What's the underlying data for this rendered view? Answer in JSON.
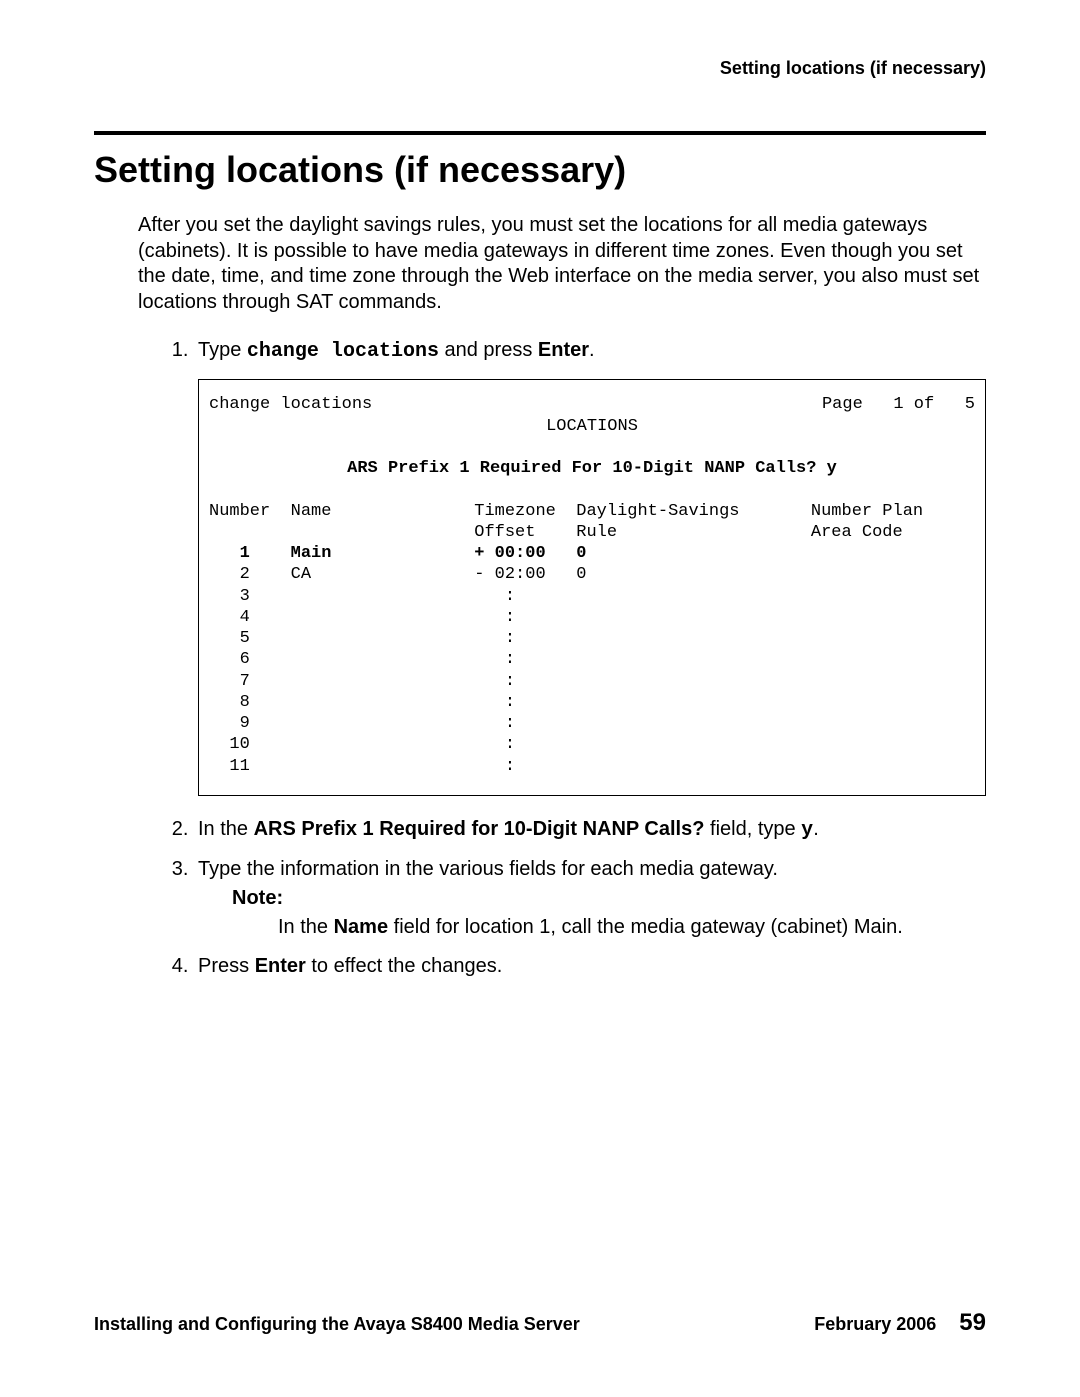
{
  "running_head": "Setting locations (if necessary)",
  "section_title": "Setting locations (if necessary)",
  "intro": "After you set the daylight savings rules, you must set the locations for all media gateways (cabinets). It is possible to have media gateways in different time zones. Even though you set the date, time, and time zone through the Web interface on the media server, you also must set locations through SAT commands.",
  "step1_prefix": "Type ",
  "step1_cmd": "change locations",
  "step1_mid": " and press ",
  "step1_enter": "Enter",
  "step1_suffix": ".",
  "terminal": {
    "cmd": "change locations",
    "page_info": "Page   1 of   5",
    "title": "LOCATIONS",
    "ars_line": "ARS Prefix 1 Required For 10-Digit NANP Calls? y",
    "hdr1": "Number  Name              Timezone  Daylight-Savings       Number Plan",
    "hdr2": "                          Offset    Rule                   Area Code",
    "rows": [
      {
        "num": "1",
        "name": "Main",
        "offset": "+ 00:00",
        "rule": "0",
        "bold": true
      },
      {
        "num": "2",
        "name": "CA",
        "offset": "- 02:00",
        "rule": "0",
        "bold": false
      },
      {
        "num": "3",
        "name": "",
        "offset": "   :",
        "rule": "",
        "bold": false
      },
      {
        "num": "4",
        "name": "",
        "offset": "   :",
        "rule": "",
        "bold": false
      },
      {
        "num": "5",
        "name": "",
        "offset": "   :",
        "rule": "",
        "bold": false
      },
      {
        "num": "6",
        "name": "",
        "offset": "   :",
        "rule": "",
        "bold": false
      },
      {
        "num": "7",
        "name": "",
        "offset": "   :",
        "rule": "",
        "bold": false
      },
      {
        "num": "8",
        "name": "",
        "offset": "   :",
        "rule": "",
        "bold": false
      },
      {
        "num": "9",
        "name": "",
        "offset": "   :",
        "rule": "",
        "bold": false
      },
      {
        "num": "10",
        "name": "",
        "offset": "   :",
        "rule": "",
        "bold": false
      },
      {
        "num": "11",
        "name": "",
        "offset": "   :",
        "rule": "",
        "bold": false
      }
    ]
  },
  "step2_prefix": "In the ",
  "step2_bold": "ARS Prefix 1 Required for 10-Digit NANP Calls?",
  "step2_mid": " field, type ",
  "step2_cmd": "y",
  "step2_suffix": ".",
  "step3": "Type the information in the various fields for each media gateway.",
  "note_label": "Note:",
  "note_prefix": "In the ",
  "note_bold": "Name",
  "note_suffix": " field for location 1, call the media gateway (cabinet) Main.",
  "step4_prefix": "Press ",
  "step4_bold": "Enter",
  "step4_suffix": " to effect the changes.",
  "footer_left": "Installing and Configuring the Avaya S8400 Media Server",
  "footer_date": "February 2006",
  "footer_page": "59"
}
